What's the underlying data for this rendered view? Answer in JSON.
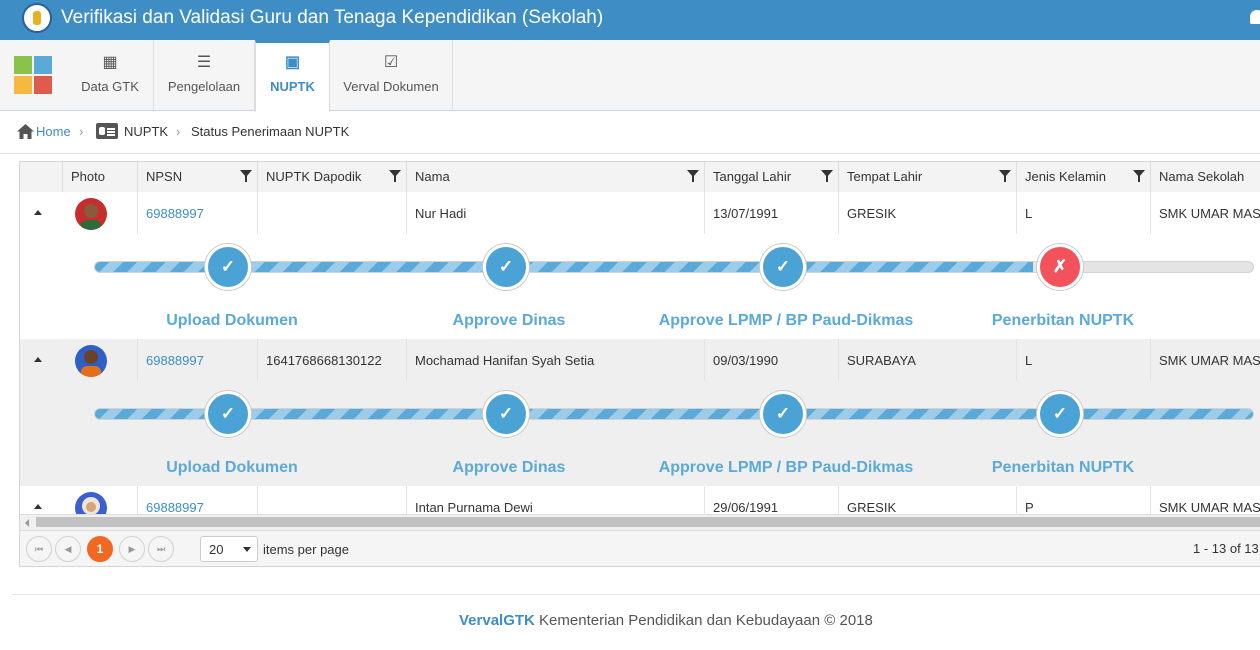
{
  "header": {
    "title": "Verifikasi dan Validasi Guru dan Tenaga Kependidikan (Sekolah)"
  },
  "tabs": [
    {
      "label": "Data GTK",
      "icon": "table-icon"
    },
    {
      "label": "Pengelolaan",
      "icon": "list-icon"
    },
    {
      "label": "NUPTK",
      "icon": "id-card-icon",
      "active": true
    },
    {
      "label": "Verval Dokumen",
      "icon": "check-square-icon"
    }
  ],
  "breadcrumb": {
    "home": "Home",
    "section": "NUPTK",
    "page": "Status Penerimaan NUPTK"
  },
  "grid": {
    "columns": [
      "Photo",
      "NPSN",
      "NUPTK Dapodik",
      "Nama",
      "Tanggal Lahir",
      "Tempat Lahir",
      "Jenis Kelamin",
      "Nama Sekolah"
    ],
    "rows": [
      {
        "npsn": "69888997",
        "nuptk": "",
        "nama": "Nur Hadi",
        "tgl": "13/07/1991",
        "tempat": "GRESIK",
        "jk": "L",
        "sekolah": "SMK UMAR MAS",
        "progress": 0.81,
        "steps": [
          "✓",
          "✓",
          "✓",
          "✗"
        ]
      },
      {
        "npsn": "69888997",
        "nuptk": "1641768668130122",
        "nama": "Mochamad Hanifan Syah Setia",
        "tgl": "09/03/1990",
        "tempat": "SURABAYA",
        "jk": "L",
        "sekolah": "SMK UMAR MAS",
        "progress": 1.0,
        "steps": [
          "✓",
          "✓",
          "✓",
          "✓"
        ]
      },
      {
        "npsn": "69888997",
        "nuptk": "",
        "nama": "Intan Purnama Dewi",
        "tgl": "29/06/1991",
        "tempat": "GRESIK",
        "jk": "P",
        "sekolah": "SMK UMAR MAS"
      }
    ],
    "step_labels": [
      "Upload Dokumen",
      "Approve Dinas",
      "Approve LPMP / BP Paud-Dikmas",
      "Penerbitan NUPTK"
    ]
  },
  "pager": {
    "first": "⏮",
    "prev": "◀",
    "current": "1",
    "next": "▶",
    "last": "⏭",
    "page_size": "20",
    "page_size_label": "items per page",
    "info": "1 - 13 of 13"
  },
  "footer": {
    "brand": "VervalGTK",
    "text": " Kementerian Pendidikan dan Kebudayaan © 2018"
  },
  "colors": {
    "header": "#3e8ec5",
    "accent": "#3e8ec5",
    "pager_current": "#f26722",
    "step_ok": "#4aa3d4",
    "step_fail": "#f2525b"
  }
}
